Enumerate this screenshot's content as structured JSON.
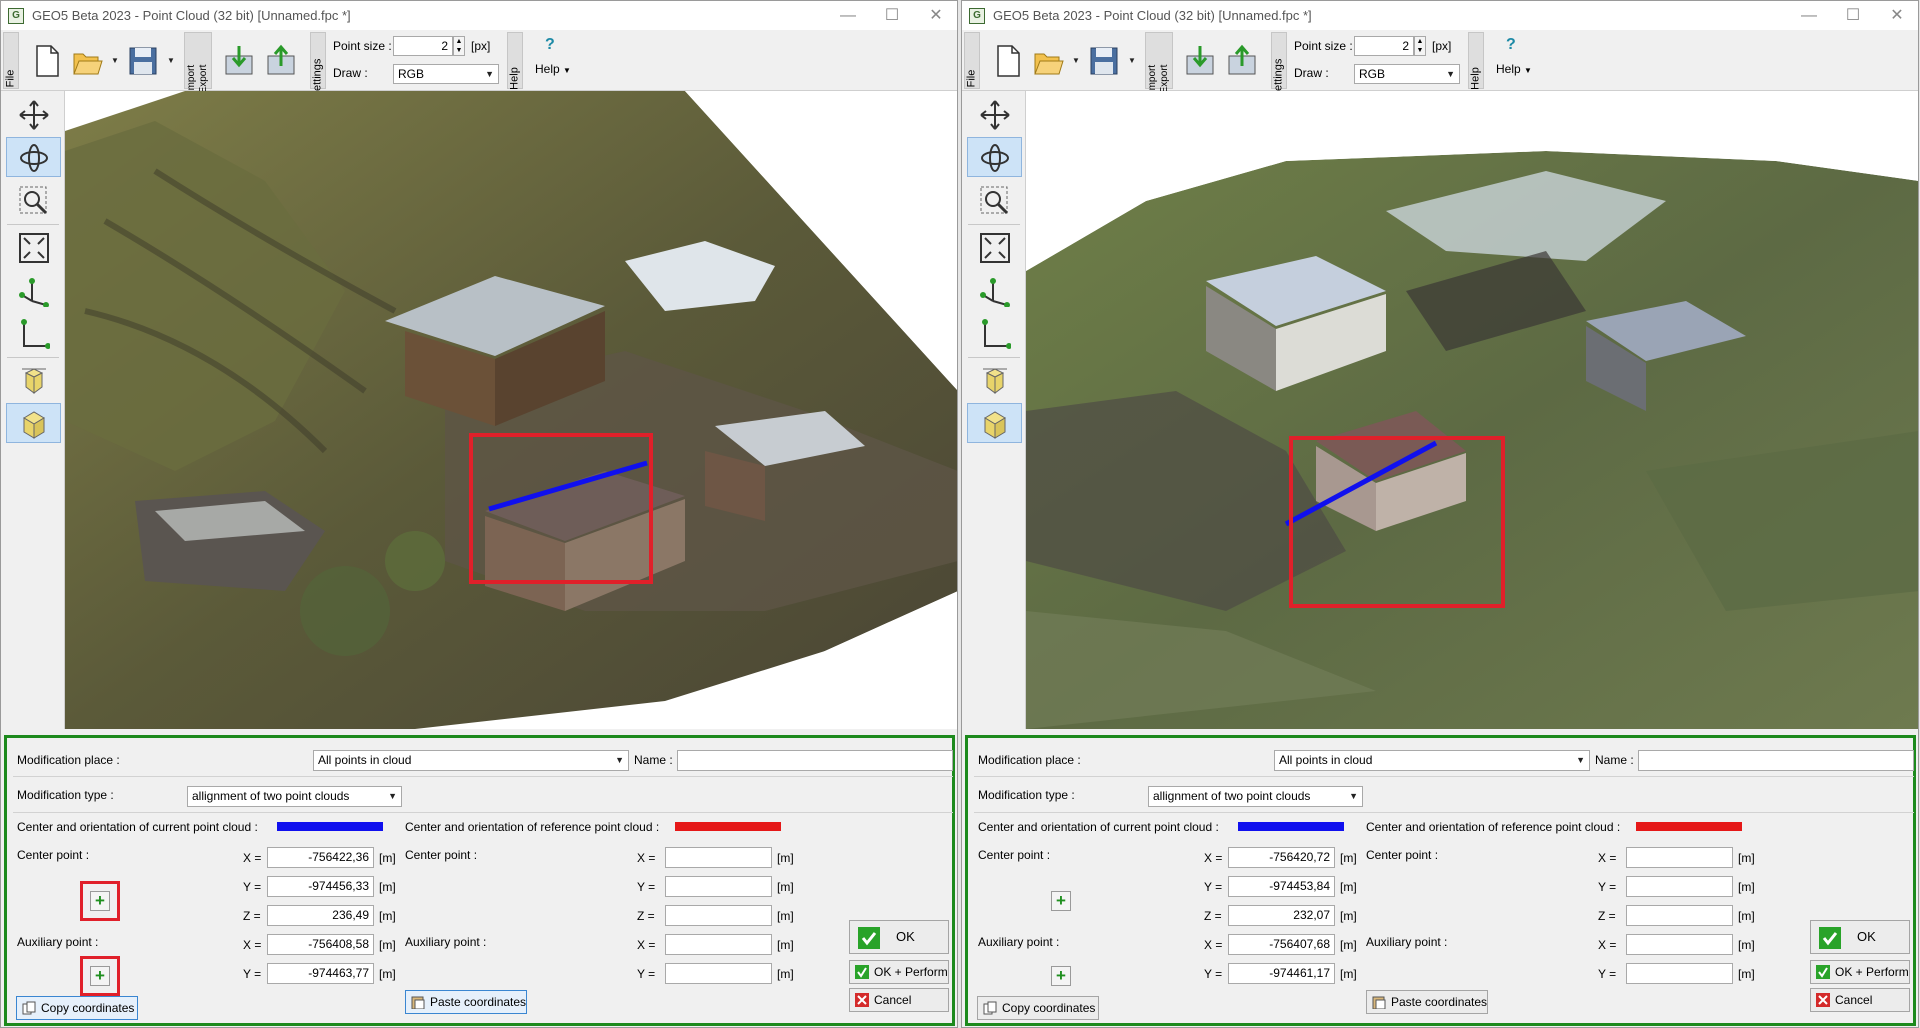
{
  "left": {
    "title": "GEO5 Beta 2023 - Point Cloud (32 bit) [Unnamed.fpc *]",
    "ribbon": {
      "file_tab": "File",
      "import_tab": "Import",
      "export_tab": "Export",
      "settings_tab": "Settings",
      "help_tab": "Help",
      "point_size_label": "Point size :",
      "point_size_value": "2",
      "point_size_unit": "[px]",
      "draw_label": "Draw :",
      "draw_value": "RGB",
      "help_button": "Help"
    },
    "tools": [
      "move-icon",
      "rotate-icon",
      "zoom-window-icon",
      "zoom-extents-icon",
      "axes-3d-icon",
      "axes-2d-icon",
      "view-top-icon",
      "view-3d-icon"
    ],
    "panel": {
      "modification_place_label": "Modification place :",
      "modification_place_value": "All points in cloud",
      "name_label": "Name :",
      "name_value": "",
      "modification_type_label": "Modification type :",
      "modification_type_value": "allignment of two point clouds",
      "current_label": "Center and orientation of current point cloud :",
      "reference_label": "Center and orientation of reference point cloud :",
      "current_color": "#1010ee",
      "reference_color": "#e51818",
      "center_point_label": "Center point :",
      "auxiliary_point_label": "Auxiliary point :",
      "x_label": "X =",
      "y_label": "Y =",
      "z_label": "Z =",
      "unit": "[m]",
      "center_x": "-756422,36",
      "center_y": "-974456,33",
      "center_z": "236,49",
      "aux_x": "-756408,58",
      "aux_y": "-974463,77",
      "ref_center_x": "",
      "ref_center_y": "",
      "ref_center_z": "",
      "ref_aux_x": "",
      "ref_aux_y": "",
      "copy_button": "Copy coordinates",
      "paste_button": "Paste coordinates",
      "ok_button": "OK",
      "ok_perform_button": "OK + Perform",
      "cancel_button": "Cancel"
    }
  },
  "right": {
    "title": "GEO5 Beta 2023 - Point Cloud (32 bit) [Unnamed.fpc *]",
    "ribbon": {
      "file_tab": "File",
      "import_tab": "Import",
      "export_tab": "Export",
      "settings_tab": "Settings",
      "help_tab": "Help",
      "point_size_label": "Point size :",
      "point_size_value": "2",
      "point_size_unit": "[px]",
      "draw_label": "Draw :",
      "draw_value": "RGB",
      "help_button": "Help"
    },
    "tools": [
      "move-icon",
      "rotate-icon",
      "zoom-window-icon",
      "zoom-extents-icon",
      "axes-3d-icon",
      "axes-2d-icon",
      "view-top-icon",
      "view-3d-icon"
    ],
    "panel": {
      "modification_place_label": "Modification place :",
      "modification_place_value": "All points in cloud",
      "name_label": "Name :",
      "name_value": "",
      "modification_type_label": "Modification type :",
      "modification_type_value": "allignment of two point clouds",
      "current_label": "Center and orientation of current point cloud :",
      "reference_label": "Center and orientation of reference point cloud :",
      "current_color": "#1010ee",
      "reference_color": "#e51818",
      "center_point_label": "Center point :",
      "auxiliary_point_label": "Auxiliary point :",
      "x_label": "X =",
      "y_label": "Y =",
      "z_label": "Z =",
      "unit": "[m]",
      "center_x": "-756420,72",
      "center_y": "-974453,84",
      "center_z": "232,07",
      "aux_x": "-756407,68",
      "aux_y": "-974461,17",
      "ref_center_x": "",
      "ref_center_y": "",
      "ref_center_z": "",
      "ref_aux_x": "",
      "ref_aux_y": "",
      "copy_button": "Copy coordinates",
      "paste_button": "Paste coordinates",
      "ok_button": "OK",
      "ok_perform_button": "OK + Perform",
      "cancel_button": "Cancel"
    }
  },
  "colors": {
    "panel_border": "#1d8a1d",
    "highlight_red": "#e0202a",
    "axis_blue": "#1010ee"
  }
}
